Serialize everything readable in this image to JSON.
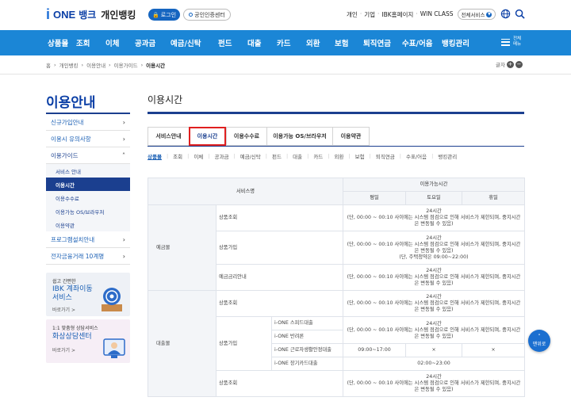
{
  "header": {
    "logo_i": "i",
    "logo_one": "ONE",
    "logo_bank": "뱅크",
    "logo_personal": "개인뱅킹",
    "login_label": "로그인",
    "cert_label": "공인인증센터",
    "top_links": [
      "개인",
      "기업",
      "IBK홈페이지",
      "WIN CLASS"
    ],
    "all_services_label": "전체서비스"
  },
  "gnb": {
    "items": [
      "상품몰",
      "조회",
      "이체",
      "공과금",
      "예금/신탁",
      "펀드",
      "대출",
      "카드",
      "외환",
      "보험",
      "퇴직연금",
      "수표/어음",
      "뱅킹관리"
    ],
    "menu_label": "전체메뉴"
  },
  "breadcrumb": {
    "items": [
      "홈",
      "개인뱅킹",
      "이용안내",
      "이용가이드"
    ],
    "current": "이용시간",
    "font_size_label": "글자"
  },
  "lnb": {
    "title": "이용안내",
    "items": [
      {
        "label": "신규가입안내"
      },
      {
        "label": "이용시 유의사항"
      },
      {
        "label": "이용가이드"
      }
    ],
    "sub_items": [
      "서비스 안내",
      "이용시간",
      "이용수수료",
      "이용가능 OS/브라우저",
      "이용약관"
    ],
    "items_after": [
      {
        "label": "프로그램설치안내"
      },
      {
        "label": "전자금융거래 10계명"
      }
    ],
    "banner1": {
      "small": "쉽고 간편한",
      "big1": "IBK 계좌이동",
      "big2": "서비스",
      "more": "바로가기 >"
    },
    "banner2": {
      "small": "1:1 맞춤형 상담서비스",
      "big1": "화상상담센터",
      "more": "바로가기 >"
    }
  },
  "content": {
    "title": "이용시간",
    "tabs": [
      "서비스안내",
      "이용시간",
      "이용수수료",
      "이용가능 OS/브라우저",
      "이용약관"
    ],
    "subtabs": [
      "상품몰",
      "조회",
      "이체",
      "공과금",
      "예금/신탁",
      "펀드",
      "대출",
      "카드",
      "외환",
      "보험",
      "퇴직연금",
      "수표/어음",
      "뱅킹관리"
    ]
  },
  "table": {
    "h_service": "서비스명",
    "h_time": "이용가능시간",
    "h_weekday": "평일",
    "h_saturday": "토요일",
    "h_holiday": "휴일",
    "cat_deposit": "예금몰",
    "cat_loan": "대출몰",
    "row_inquiry": "상품조회",
    "row_join": "상품가입",
    "row_rate": "예금금리안내",
    "loan_smart": "i-ONE 스피드대출",
    "loan_jeonse": "i-ONE 반려론",
    "loan_worker": "i-ONE 근로자생활안정대출",
    "loan_card": "i-ONE 장기카드대출",
    "time_24": "24시간",
    "time_note": "(단, 00:00 ~ 00:10 사이에는 시스템 점검으로 인해 서비스가 제한되며, 중지시간은 변동될 수 있음)",
    "time_note_install": "(단, 주택청약은 09:00~22:00)",
    "worker_weekday": "09:00~17:00",
    "x_mark": "×",
    "card_time": "02:00~23:00"
  },
  "top_button": {
    "label": "맨위로"
  }
}
